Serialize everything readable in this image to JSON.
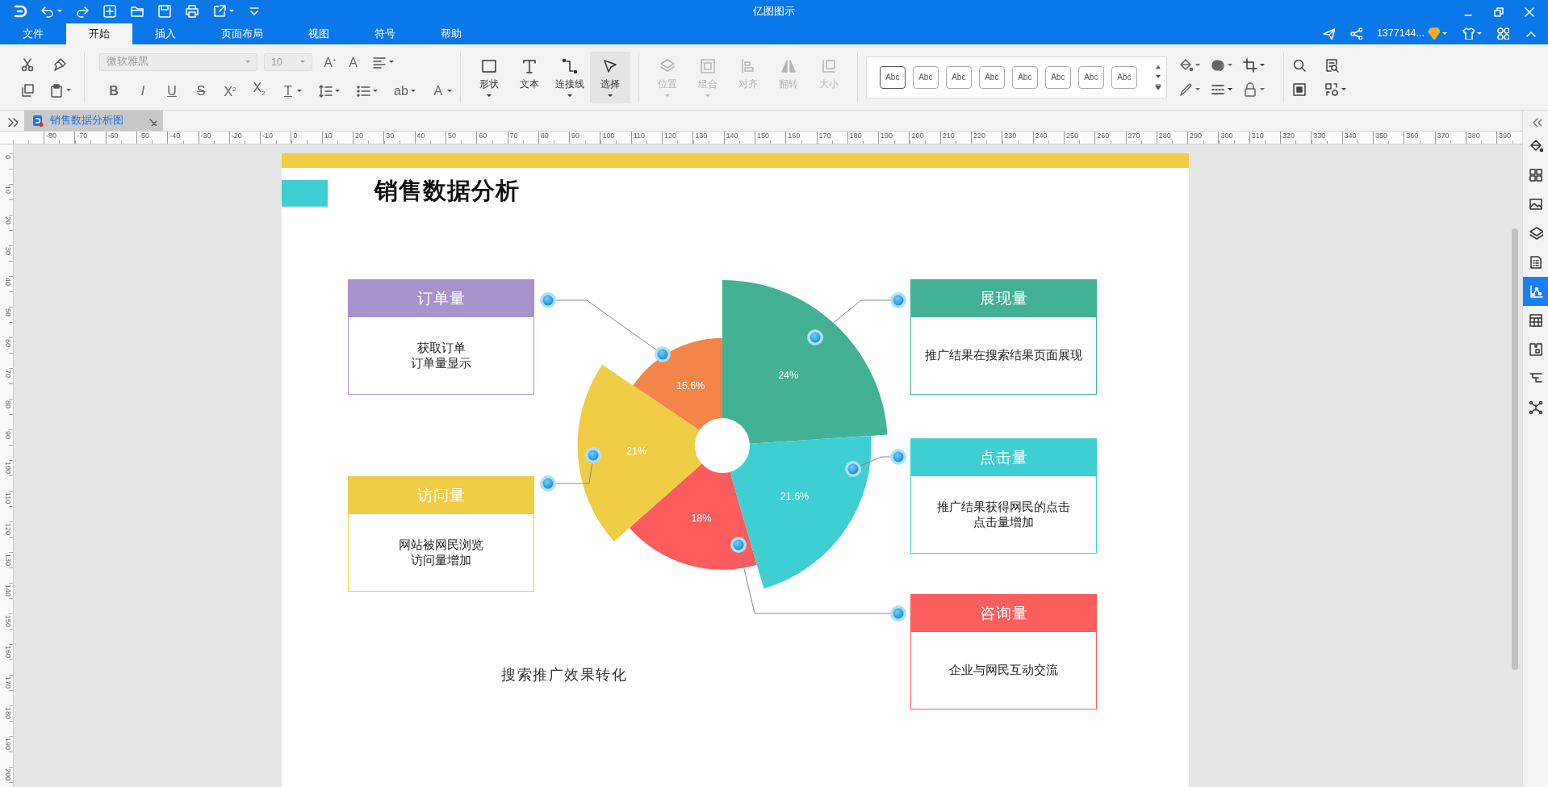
{
  "window": {
    "title": "亿图图示"
  },
  "menu_tabs": [
    {
      "label": "文件",
      "selected": false
    },
    {
      "label": "开始",
      "selected": true
    },
    {
      "label": "插入",
      "selected": false
    },
    {
      "label": "页面布局",
      "selected": false
    },
    {
      "label": "视图",
      "selected": false
    },
    {
      "label": "符号",
      "selected": false
    },
    {
      "label": "帮助",
      "selected": false
    }
  ],
  "account": {
    "user": "1377144..."
  },
  "ribbon": {
    "font_name": "微软雅黑",
    "font_size": "10",
    "size_buttons": [
      "A$^{+}$",
      "A$^{-}$"
    ],
    "format_glyphs": [
      "B",
      "I",
      "U",
      "S",
      "X$^{2}$",
      "X$_{2}$",
      "T",
      "ab",
      "A"
    ],
    "tools": [
      {
        "label": "形状",
        "selected": false
      },
      {
        "label": "文本",
        "selected": false
      },
      {
        "label": "连接线",
        "selected": false
      },
      {
        "label": "选择",
        "selected": true
      }
    ],
    "arrange": [
      {
        "label": "位置",
        "disabled": true
      },
      {
        "label": "组合",
        "disabled": true
      },
      {
        "label": "对齐",
        "disabled": true
      },
      {
        "label": "翻转",
        "disabled": true
      },
      {
        "label": "大小",
        "disabled": true
      }
    ],
    "styles": [
      {
        "label": "Abc",
        "selected": true
      },
      {
        "label": "Abc",
        "selected": false
      },
      {
        "label": "Abc",
        "selected": false
      },
      {
        "label": "Abc",
        "selected": false
      },
      {
        "label": "Abc",
        "selected": false
      },
      {
        "label": "Abc",
        "selected": false
      },
      {
        "label": "Abc",
        "selected": false
      },
      {
        "label": "Abc",
        "selected": false
      }
    ]
  },
  "document_tabs": [
    {
      "label": "销售数据分析图",
      "selected": true
    }
  ],
  "ruler": {
    "horizontal": [
      "-80",
      "-70",
      "-60",
      "-50",
      "-40",
      "-30",
      "-20",
      "-10",
      "0",
      "10",
      "20",
      "30",
      "40",
      "50",
      "60",
      "70",
      "80",
      "90",
      "100",
      "110",
      "120",
      "130",
      "140",
      "150",
      "160",
      "170",
      "180",
      "190",
      "200",
      "210",
      "220",
      "230",
      "240",
      "250",
      "260",
      "270",
      "280",
      "290",
      "300",
      "310",
      "320",
      "330",
      "340",
      "350",
      "360",
      "370",
      "380",
      "390"
    ],
    "vertical": [
      "0",
      "10",
      "20",
      "30",
      "40",
      "50",
      "60",
      "70",
      "80",
      "90",
      "100",
      "110",
      "120",
      "130",
      "140",
      "150",
      "160",
      "170",
      "180",
      "190",
      "200"
    ]
  },
  "page": {
    "title": "销售数据分析",
    "caption": "搜索推广效果转化",
    "rose_segments": [
      {
        "value_label": "24%",
        "color": "#43b194"
      },
      {
        "value_label": "21.6%",
        "color": "#3ecfd3"
      },
      {
        "value_label": "18%",
        "color": "#fc5c5c"
      },
      {
        "value_label": "21%",
        "color": "#efcd44"
      },
      {
        "value_label": "15.6%",
        "color": "#f38548"
      }
    ],
    "callouts": [
      {
        "title": "订单量",
        "lines": [
          "获取订单",
          "订单量显示"
        ],
        "color": "#a893cc"
      },
      {
        "title": "展现量",
        "lines": [
          "推广结果在搜索结果页面展现"
        ],
        "color": "#43b195"
      },
      {
        "title": "点击量",
        "lines": [
          "推广结果获得网民的点击",
          "点击量增加"
        ],
        "color": "#3ecfd3"
      },
      {
        "title": "访问量",
        "lines": [
          "网站被网民浏览",
          "访问量增加"
        ],
        "color": "#efcd44"
      },
      {
        "title": "咨询量",
        "lines": [
          "企业与网民互动交流"
        ],
        "color": "#fc5d5d"
      }
    ]
  },
  "side_panel": {
    "items": [
      {
        "selected": false
      },
      {
        "selected": false
      },
      {
        "selected": false
      },
      {
        "selected": false
      },
      {
        "selected": false
      },
      {
        "selected": true
      },
      {
        "selected": false
      },
      {
        "selected": false
      },
      {
        "selected": false
      },
      {
        "selected": false
      }
    ]
  }
}
